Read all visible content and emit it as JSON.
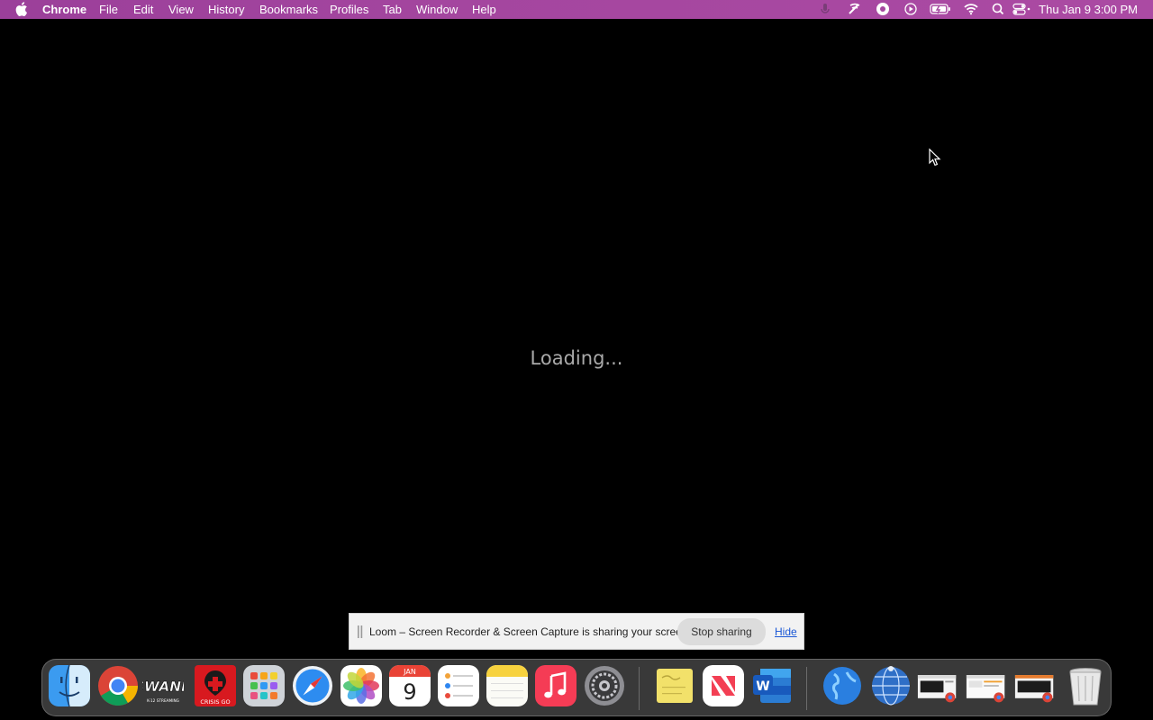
{
  "menubar": {
    "app_name": "Chrome",
    "items": [
      "File",
      "Edit",
      "View",
      "History",
      "Bookmarks",
      "Profiles",
      "Tab",
      "Window",
      "Help"
    ],
    "clock": "Thu Jan 9  3:00 PM"
  },
  "content": {
    "loading_text": "Loading..."
  },
  "loom_banner": {
    "message": "Loom – Screen Recorder & Screen Capture is sharing your screen.",
    "stop_label": "Stop sharing",
    "hide_label": "Hide"
  },
  "dock": {
    "calendar_month": "JAN",
    "calendar_day": "9",
    "swank_text": "SWANK",
    "swank_sub": "K-12 STREAMING",
    "crisisgo_text": "CRISIS GO",
    "word_letter": "W"
  },
  "colors": {
    "menubar": "#a4469f",
    "background": "#000000",
    "loading_text": "#a9a9a9",
    "hide_link": "#1a57d6"
  }
}
